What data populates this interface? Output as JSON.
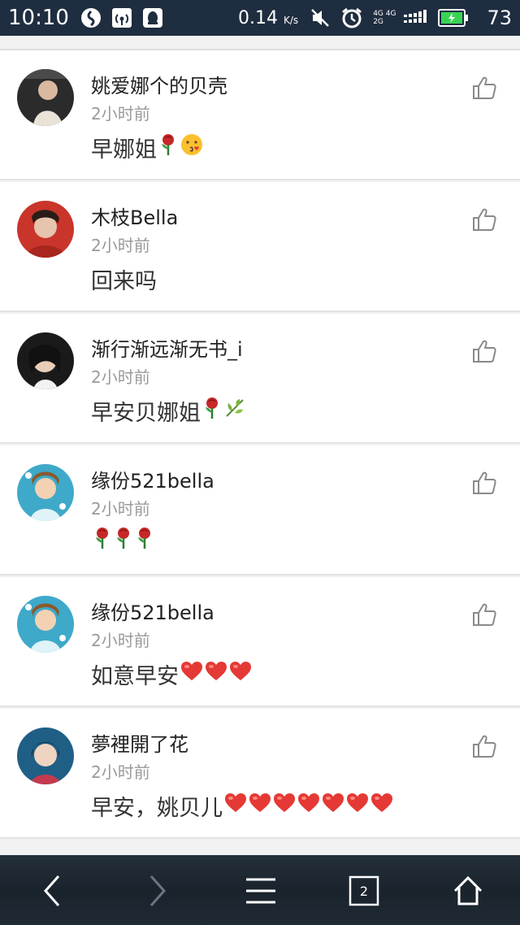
{
  "status_bar": {
    "time": "10:10",
    "speed": "0.14",
    "speed_unit": "K/s",
    "net_top": "4G 4G",
    "net_bottom": "2G",
    "battery": "73"
  },
  "comments": [
    {
      "name": "姚爱娜个的贝壳",
      "time": "2小时前",
      "text": "早娜姐",
      "emojis": [
        "rose",
        "kiss-face"
      ]
    },
    {
      "name": "木枝Bella",
      "time": "2小时前",
      "text": "回来吗",
      "emojis": []
    },
    {
      "name": "渐行渐远渐无书_i",
      "time": "2小时前",
      "text": "早安贝娜姐",
      "emojis": [
        "rose",
        "leaf"
      ]
    },
    {
      "name": "缘份521bella",
      "time": "2小时前",
      "text": "",
      "emojis": [
        "rose",
        "rose",
        "rose"
      ]
    },
    {
      "name": "缘份521bella",
      "time": "2小时前",
      "text": "如意早安",
      "emojis": [
        "heart",
        "heart",
        "heart"
      ]
    },
    {
      "name": "夢裡開了花",
      "time": "2小时前",
      "text": "早安，姚贝儿",
      "emojis": [
        "heart",
        "heart",
        "heart",
        "heart",
        "heart",
        "heart",
        "heart"
      ]
    }
  ],
  "nav": {
    "tab_count": "2"
  },
  "colors": {
    "status_bar_bg": "#1f2d40",
    "heart": "#e53935",
    "rose": "#c62828",
    "battery_fill": "#39d353"
  }
}
